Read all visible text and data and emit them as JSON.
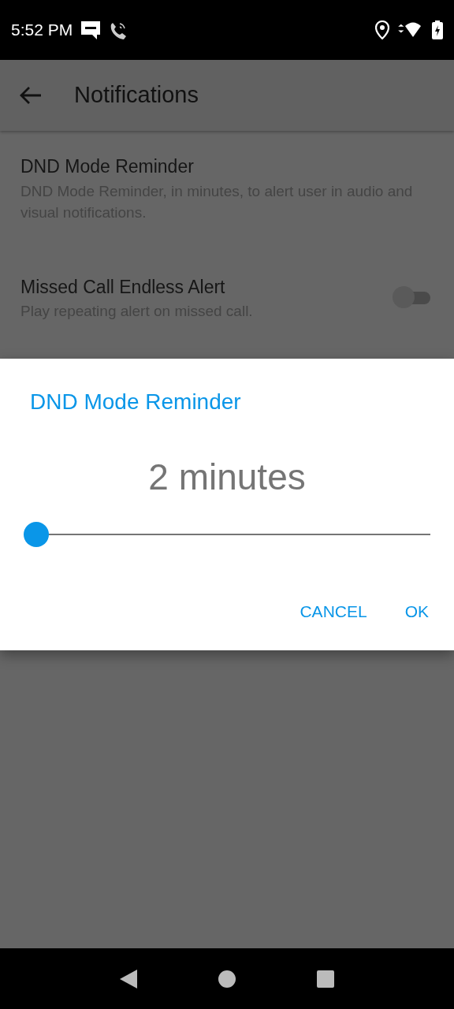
{
  "status_bar": {
    "time": "5:52 PM"
  },
  "app_bar": {
    "title": "Notifications"
  },
  "settings": [
    {
      "kind": "text",
      "title": "DND Mode Reminder",
      "summary": "DND Mode Reminder, in minutes, to alert user in audio and visual notifications."
    },
    {
      "kind": "switch",
      "title": "Missed Call Endless Alert",
      "summary": "Play repeating alert on missed call.",
      "on": false
    }
  ],
  "dialog": {
    "title": "DND Mode Reminder",
    "value": "2 minutes",
    "slider": {
      "level": 0
    },
    "buttons": [
      "CANCEL",
      "OK"
    ]
  }
}
